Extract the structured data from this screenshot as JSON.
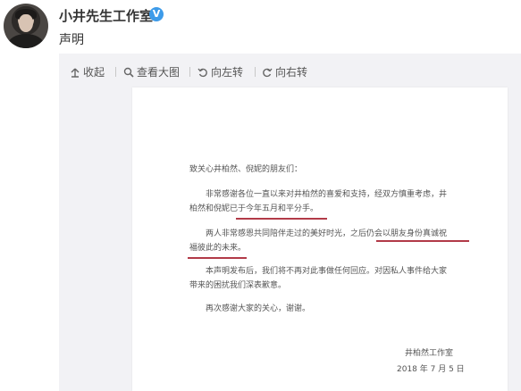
{
  "post": {
    "author_name": "小井先生工作室",
    "verified_badge": "V",
    "text": "声明",
    "avatar_icon": "avatar-portrait"
  },
  "toolbar": {
    "collapse_label": "收起",
    "view_large_label": "查看大图",
    "rotate_left_label": "向左转",
    "rotate_right_label": "向右转"
  },
  "letter": {
    "greeting": "致关心井柏然、倪妮的朋友们：",
    "para1_line1": "非常感谢各位一直以来对井柏然的喜爱和支持，经双方慎重考虑，井",
    "para1_line2": "柏然和倪妮已于今年五月和平分手。",
    "para2_line1": "两人非常感恩共同陪伴走过的美好时光，之后仍会以朋友身份真诚祝",
    "para2_line2": "福彼此的未来。",
    "para3_line1": "本声明发布后，我们将不再对此事做任何回应。对因私人事件给大家",
    "para3_line2": "带来的困扰我们深表歉意。",
    "para4": "再次感谢大家的关心，谢谢。",
    "signature": "井柏然工作室",
    "date": "2018 年 7 月 5 日"
  },
  "colors": {
    "underline": "#b23a48",
    "verified": "#3d9be9",
    "card_bg": "#f2f2f5"
  }
}
